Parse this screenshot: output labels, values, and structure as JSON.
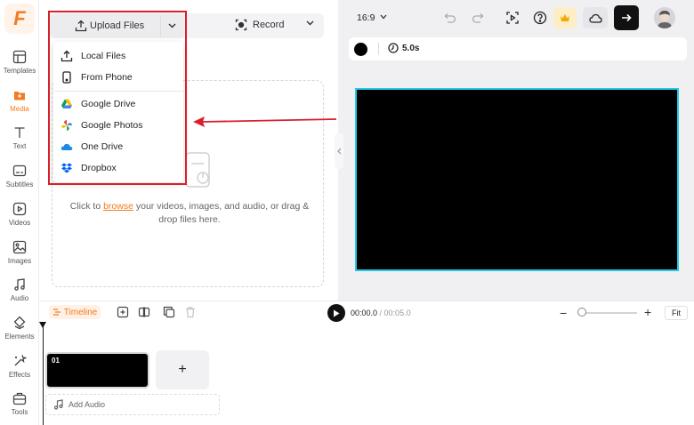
{
  "colors": {
    "accent": "#f47b20",
    "highlight": "#d9202a",
    "canvas_border": "#24c8e8"
  },
  "logo": {
    "letter": "F"
  },
  "rail": {
    "items": [
      {
        "label": "Templates",
        "icon": "templates-icon"
      },
      {
        "label": "Media",
        "icon": "media-icon",
        "active": true
      },
      {
        "label": "Text",
        "icon": "text-icon"
      },
      {
        "label": "Subtitles",
        "icon": "subtitles-icon"
      },
      {
        "label": "Videos",
        "icon": "videos-icon"
      },
      {
        "label": "Images",
        "icon": "images-icon"
      },
      {
        "label": "Audio",
        "icon": "audio-icon"
      },
      {
        "label": "Elements",
        "icon": "elements-icon"
      },
      {
        "label": "Effects",
        "icon": "effects-icon"
      },
      {
        "label": "Tools",
        "icon": "tools-icon"
      }
    ]
  },
  "upload": {
    "button_label": "Upload Files",
    "record_label": "Record",
    "dropdown": [
      {
        "label": "Local Files",
        "icon": "upload-icon"
      },
      {
        "label": "From Phone",
        "icon": "phone-icon"
      },
      {
        "label": "Google Drive",
        "icon": "google-drive-icon"
      },
      {
        "label": "Google Photos",
        "icon": "google-photos-icon"
      },
      {
        "label": "One Drive",
        "icon": "onedrive-icon"
      },
      {
        "label": "Dropbox",
        "icon": "dropbox-icon"
      }
    ]
  },
  "dropzone": {
    "prefix": "Click to ",
    "link": "browse",
    "suffix": " your videos, images, and audio, or drag & drop files here."
  },
  "preview": {
    "aspect_ratio": "16:9",
    "duration": "5.0s"
  },
  "timeline": {
    "tag": "Timeline",
    "current_time": "00:00.0",
    "separator": " / ",
    "total_time": "00:05.0",
    "fit_label": "Fit",
    "zoom_minus": "−",
    "zoom_plus": "+",
    "clip_number": "01",
    "add_clip": "+",
    "add_audio": "Add Audio"
  }
}
